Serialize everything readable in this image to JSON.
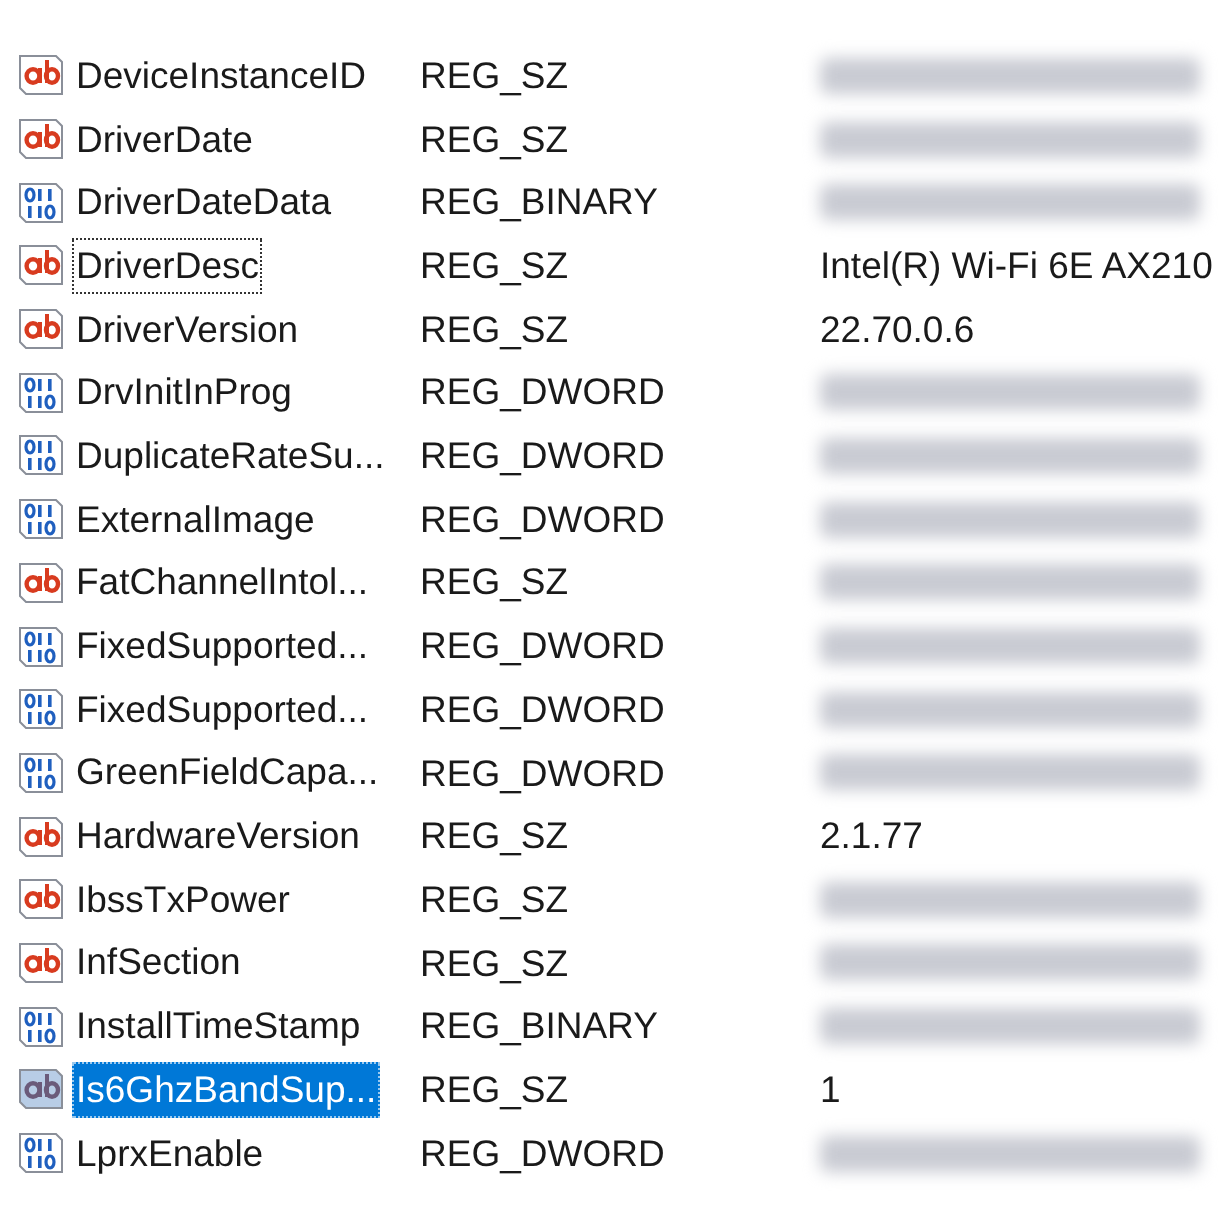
{
  "rows": [
    {
      "name": "DeviceInstanceID",
      "type": "REG_SZ",
      "kind": "string",
      "data": {
        "kind": "blurred"
      },
      "selected": false,
      "focused": false
    },
    {
      "name": "DriverDate",
      "type": "REG_SZ",
      "kind": "string",
      "data": {
        "kind": "blurred"
      },
      "selected": false,
      "focused": false
    },
    {
      "name": "DriverDateData",
      "type": "REG_BINARY",
      "kind": "binary",
      "data": {
        "kind": "blurred"
      },
      "selected": false,
      "focused": false
    },
    {
      "name": "DriverDesc",
      "type": "REG_SZ",
      "kind": "string",
      "data": {
        "kind": "text",
        "text": "Intel(R) Wi-Fi 6E AX210"
      },
      "selected": false,
      "focused": true
    },
    {
      "name": "DriverVersion",
      "type": "REG_SZ",
      "kind": "string",
      "data": {
        "kind": "text",
        "text": "22.70.0.6"
      },
      "selected": false,
      "focused": false
    },
    {
      "name": "DrvInitInProg",
      "type": "REG_DWORD",
      "kind": "binary",
      "data": {
        "kind": "blurred"
      },
      "selected": false,
      "focused": false
    },
    {
      "name": "DuplicateRateSu...",
      "type": "REG_DWORD",
      "kind": "binary",
      "data": {
        "kind": "blurred"
      },
      "selected": false,
      "focused": false
    },
    {
      "name": "ExternalImage",
      "type": "REG_DWORD",
      "kind": "binary",
      "data": {
        "kind": "blurred"
      },
      "selected": false,
      "focused": false
    },
    {
      "name": "FatChannelIntol...",
      "type": "REG_SZ",
      "kind": "string",
      "data": {
        "kind": "blurred"
      },
      "selected": false,
      "focused": false
    },
    {
      "name": "FixedSupported...",
      "type": "REG_DWORD",
      "kind": "binary",
      "data": {
        "kind": "blurred"
      },
      "selected": false,
      "focused": false
    },
    {
      "name": "FixedSupported...",
      "type": "REG_DWORD",
      "kind": "binary",
      "data": {
        "kind": "blurred"
      },
      "selected": false,
      "focused": false
    },
    {
      "name": "GreenFieldCapa...",
      "type": "REG_DWORD",
      "kind": "binary",
      "data": {
        "kind": "blurred"
      },
      "selected": false,
      "focused": false
    },
    {
      "name": "HardwareVersion",
      "type": "REG_SZ",
      "kind": "string",
      "data": {
        "kind": "text",
        "text": "2.1.77"
      },
      "selected": false,
      "focused": false
    },
    {
      "name": "IbssTxPower",
      "type": "REG_SZ",
      "kind": "string",
      "data": {
        "kind": "blurred"
      },
      "selected": false,
      "focused": false
    },
    {
      "name": "InfSection",
      "type": "REG_SZ",
      "kind": "string",
      "data": {
        "kind": "blurred"
      },
      "selected": false,
      "focused": false
    },
    {
      "name": "InstallTimeStamp",
      "type": "REG_BINARY",
      "kind": "binary",
      "data": {
        "kind": "blurred"
      },
      "selected": false,
      "focused": false
    },
    {
      "name": "Is6GhzBandSup...",
      "type": "REG_SZ",
      "kind": "string",
      "data": {
        "kind": "text",
        "text": "1"
      },
      "selected": true,
      "focused": false
    },
    {
      "name": "LprxEnable",
      "type": "REG_DWORD",
      "kind": "binary",
      "data": {
        "kind": "blurred"
      },
      "selected": false,
      "focused": false
    }
  ]
}
